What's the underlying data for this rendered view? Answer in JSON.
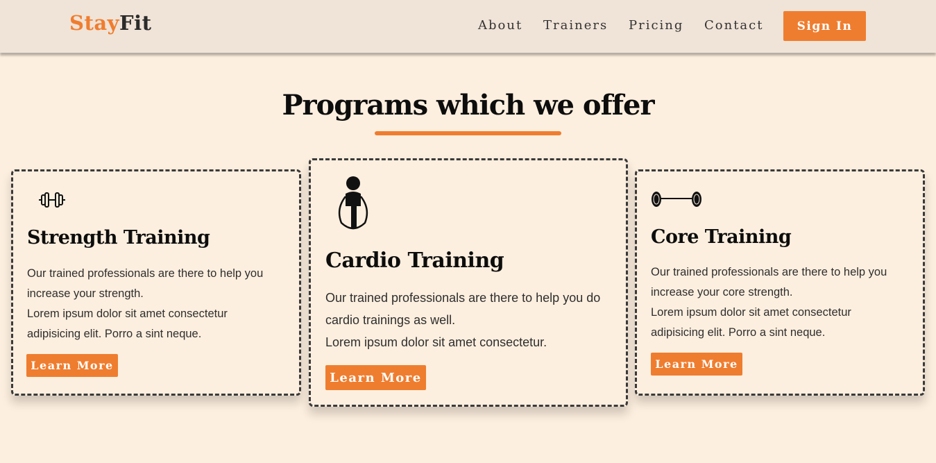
{
  "header": {
    "brand_part1": "Stay",
    "brand_part2": "Fit",
    "nav": [
      "About",
      "Trainers",
      "Pricing",
      "Contact"
    ],
    "signin_label": "Sign In"
  },
  "section": {
    "title": "Programs which we offer"
  },
  "cards": [
    {
      "icon": "dumbbell-icon",
      "title": "Strength Training",
      "lines": [
        "Our trained professionals are there to help you",
        "increase your strength.",
        "Lorem ipsum dolor sit amet consectetur",
        "adipisicing elit. Porro a sint neque."
      ],
      "button": "Learn More"
    },
    {
      "icon": "jump-rope-icon",
      "title": "Cardio Training",
      "lines": [
        "Our trained professionals are there to help you do",
        "cardio trainings as well.",
        "Lorem ipsum dolor sit amet consectetur."
      ],
      "button": "Learn More"
    },
    {
      "icon": "barbell-icon",
      "title": "Core Training",
      "lines": [
        "Our trained professionals are there to help you",
        "increase your core strength.",
        "Lorem ipsum dolor sit amet consectetur",
        "adipisicing elit. Porro a sint neque."
      ],
      "button": "Learn More"
    }
  ],
  "colors": {
    "accent": "#ef7d2f",
    "background": "#fdefdf",
    "header_bg": "#f0e3d7"
  }
}
